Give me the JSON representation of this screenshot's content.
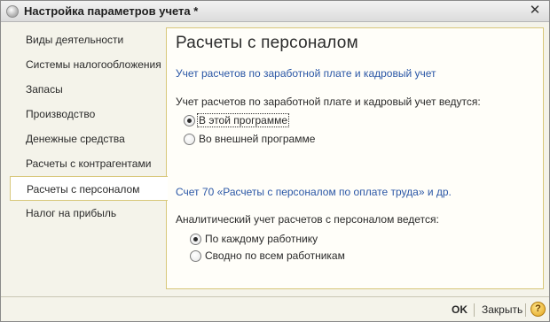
{
  "window": {
    "title": "Настройка параметров учета *",
    "close_symbol": "✕"
  },
  "sidebar": {
    "items": [
      {
        "label": "Виды деятельности"
      },
      {
        "label": "Системы налогообложения"
      },
      {
        "label": "Запасы"
      },
      {
        "label": "Производство"
      },
      {
        "label": "Денежные средства"
      },
      {
        "label": "Расчеты с контрагентами"
      },
      {
        "label": "Расчеты с персоналом",
        "active": true
      },
      {
        "label": "Налог на прибыль"
      }
    ]
  },
  "main": {
    "heading": "Расчеты с персоналом",
    "section1": {
      "link": "Учет расчетов по заработной плате и кадровый учет",
      "question": "Учет расчетов по заработной плате и кадровый учет ведутся:",
      "options": [
        {
          "label": "В этой программе",
          "selected": true
        },
        {
          "label": "Во внешней программе",
          "selected": false
        }
      ]
    },
    "section2": {
      "link": "Счет 70 «Расчеты с персоналом по оплате труда» и др.",
      "question": "Аналитический учет расчетов с персоналом ведется:",
      "options": [
        {
          "label": "По каждому работнику",
          "selected": true
        },
        {
          "label": "Сводно по всем работникам",
          "selected": false
        }
      ]
    }
  },
  "footer": {
    "ok_label": "OK",
    "close_label": "Закрыть",
    "help_label": "?"
  },
  "colors": {
    "accent_border": "#d8c77a",
    "link": "#2b57a6",
    "background": "#f4f3ea"
  }
}
